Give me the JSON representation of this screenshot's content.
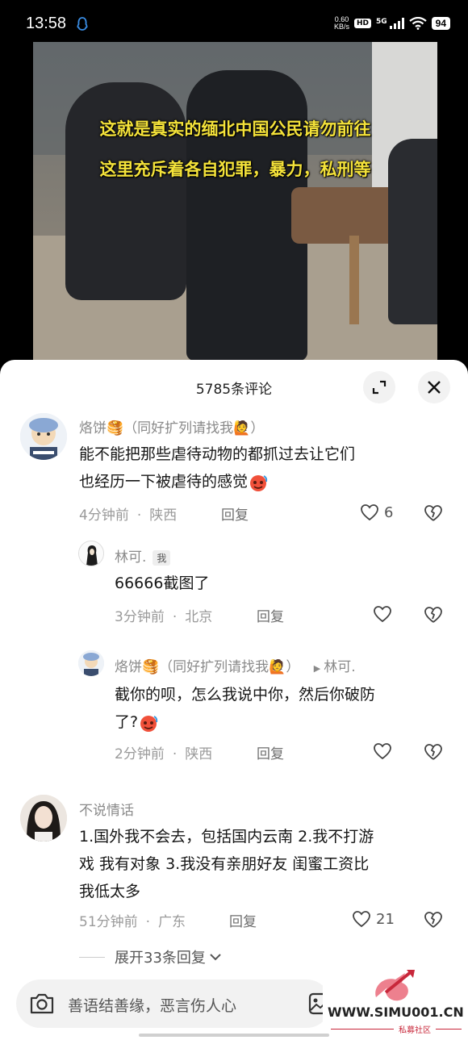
{
  "status_bar": {
    "time": "13:58",
    "net_speed_value": "0.60",
    "net_speed_unit": "KB/s",
    "hd": "HD",
    "network": "5G",
    "battery": "94"
  },
  "video": {
    "caption_line1": "这就是真实的缅北中国公民请勿前往",
    "caption_line2": "这里充斥着各自犯罪，暴力，私刑等"
  },
  "comments_sheet": {
    "title": "5785条评论",
    "expand_icon": "expand-icon",
    "close_icon": "close-icon"
  },
  "comments": [
    {
      "author": "烙饼🥞（同好扩列请找我🙋）",
      "text_line1": "能不能把那些虐待动物的都抓过去让它们",
      "text_line2": "也经历一下被虐待的感觉",
      "time": "4分钟前",
      "location": "陕西",
      "reply_label": "回复",
      "likes": "6"
    },
    {
      "author": "林可.",
      "me_badge": "我",
      "text": "66666截图了",
      "time": "3分钟前",
      "location": "北京",
      "reply_label": "回复"
    },
    {
      "author": "烙饼🥞（同好扩列请找我🙋）",
      "reply_to": "林可.",
      "text_line1": "截你的呗，怎么我说中你，然后你破防",
      "text_line2": "了?",
      "time": "2分钟前",
      "location": "陕西",
      "reply_label": "回复"
    },
    {
      "author": "不说情话",
      "text_line1": "1.国外我不会去，包括国内云南 2.我不打游",
      "text_line2": "戏 我有对象 3.我没有亲朋好友 闺蜜工资比",
      "text_line3": "我低太多",
      "time": "51分钟前",
      "location": "广东",
      "reply_label": "回复",
      "likes": "21"
    }
  ],
  "expand_replies": "展开33条回复",
  "input": {
    "placeholder": "善语结善缘，恶言伤人心"
  },
  "watermark": {
    "site": "WWW.SIMU001.CN",
    "sub": "私募社区"
  },
  "colors": {
    "caption": "#f4e23a",
    "watermark_red": "#c8283b"
  }
}
